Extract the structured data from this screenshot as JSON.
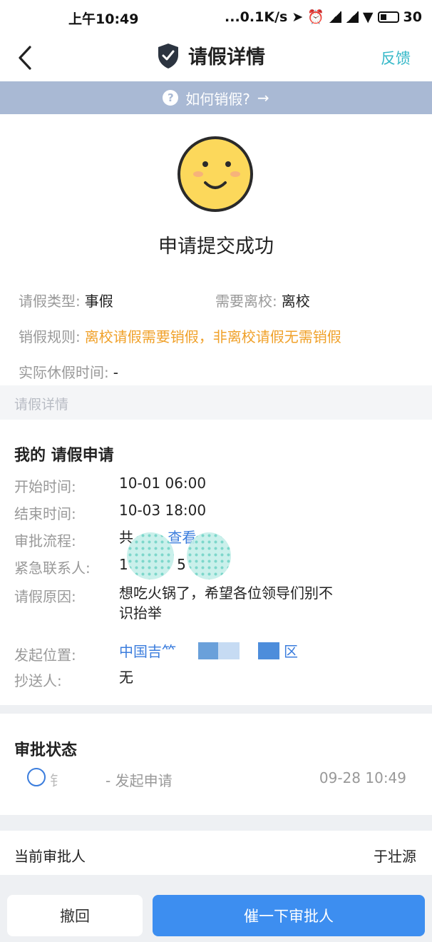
{
  "status_bar": {
    "time": "上午10:49",
    "network_speed": "...0.1K/s",
    "battery": "30"
  },
  "nav": {
    "title": "请假详情",
    "feedback": "反馈",
    "back_icon": "chevron-left-icon",
    "shield_icon": "shield-check-icon"
  },
  "howto": {
    "text": "如何销假?",
    "arrow": "→"
  },
  "result": {
    "icon": "smiley-face-icon",
    "text": "申请提交成功"
  },
  "summary": {
    "leave_type_label": "请假类型:",
    "leave_type_value": "事假",
    "leave_school_label": "需要离校:",
    "leave_school_value": "离校",
    "rule_label": "销假规则:",
    "rule_value": "离校请假需要销假，非离校请假无需销假",
    "actual_label": "实际休假时间:",
    "actual_value": "-"
  },
  "section_label": "请假详情",
  "detail": {
    "title": "我的 请假申请",
    "start_label": "开始时间:",
    "start_value": "10-01 06:00",
    "end_label": "结束时间:",
    "end_value": "10-03 18:00",
    "flow_label": "审批流程:",
    "flow_value": "共",
    "flow_link": "查看",
    "contact_label": "紧急联系人:",
    "contact_value": "1",
    "contact_value_tail": "5",
    "reason_label": "请假原因:",
    "reason_value_line1": "想吃火锅了，希望各位领导们别不",
    "reason_value_line2": "识抬举",
    "location_label": "发起位置:",
    "location_value": "中国吉⺮",
    "location_tail": "区",
    "cc_label": "抄送人:",
    "cc_value": "无"
  },
  "approval_status": {
    "title": "审批状态",
    "name": "钅",
    "action": "- 发起申请",
    "time": "09-28 10:49"
  },
  "approver": {
    "label": "当前审批人",
    "name": "于壮源"
  },
  "buttons": {
    "withdraw": "撤回",
    "urge": "催一下审批人"
  },
  "colors": {
    "accent_blue": "#3d8ef0",
    "warning_orange": "#f0a12a",
    "feedback_teal": "#35b8c8",
    "howto_bar": "#a9b9d4"
  }
}
